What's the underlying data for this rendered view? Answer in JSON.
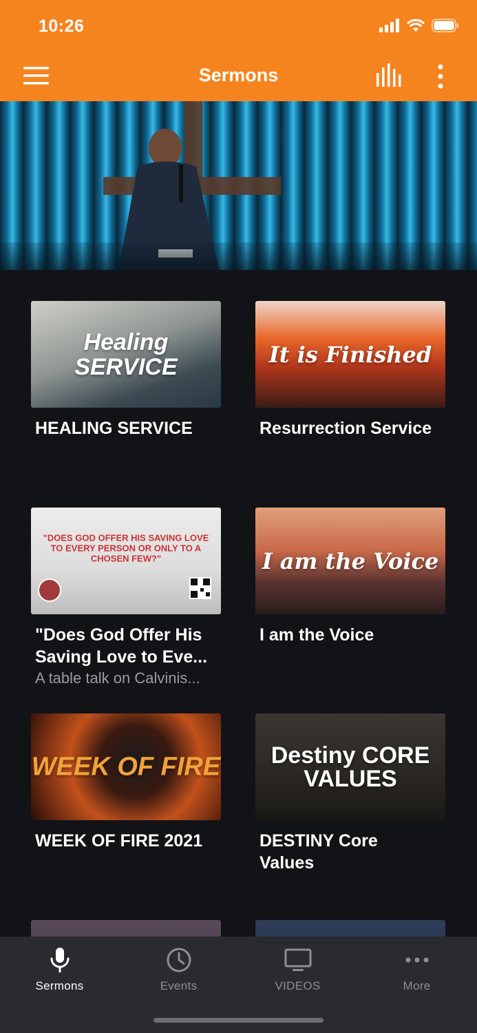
{
  "status_bar": {
    "time": "10:26"
  },
  "app_bar": {
    "title": "Sermons",
    "icons": [
      "hamburger-menu-icon",
      "bar-chart-icon",
      "more-vertical-icon"
    ]
  },
  "theme": {
    "accent": "#F5841F",
    "background": "#121316",
    "tabbar": "#2a2b2f"
  },
  "sermons": [
    {
      "title": "HEALING SERVICE",
      "thumb_text": "Healing SERVICE"
    },
    {
      "title": "Resurrection Service",
      "thumb_text": "It is Finished"
    },
    {
      "title": "\"Does God Offer His Saving Love to Eve...",
      "subtitle": "A table talk on Calvinis...",
      "thumb_text": "\"DOES GOD OFFER HIS SAVING LOVE TO EVERY PERSON OR ONLY TO A CHOSEN FEW?\""
    },
    {
      "title": "I am the Voice",
      "thumb_text": "I am the Voice"
    },
    {
      "title": "WEEK OF FIRE 2021",
      "thumb_text": "WEEK OF FIRE"
    },
    {
      "title": "DESTINY Core Values",
      "thumb_text": "Destiny CORE VALUES"
    }
  ],
  "tabs": [
    {
      "label": "Sermons",
      "icon": "microphone-icon",
      "active": true
    },
    {
      "label": "Events",
      "icon": "clock-icon",
      "active": false
    },
    {
      "label": "VIDEOS",
      "icon": "tv-icon",
      "active": false
    },
    {
      "label": "More",
      "icon": "more-horizontal-icon",
      "active": false
    }
  ]
}
